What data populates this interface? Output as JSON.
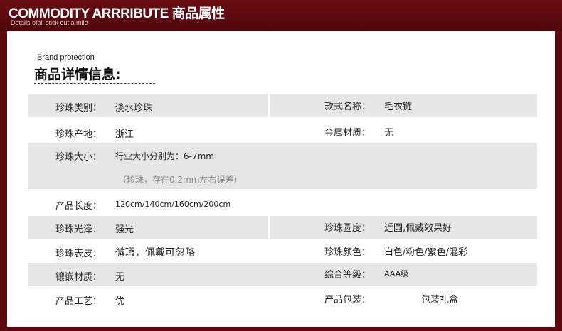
{
  "header": {
    "title": "COMMODITY ARRRIBUTE 商品属性",
    "subtitle": "Details ofall stick out a mile"
  },
  "brand": {
    "en": "Brand protection",
    "cn": "商品详情信息:",
    "dashes": "- - - - - - - - - - - - - - - -"
  },
  "rows": [
    {
      "left_label": "珍珠类别：",
      "left_value": "淡水珍珠",
      "right_label": "款式名称：",
      "right_value": "毛衣链"
    },
    {
      "left_label": "珍珠产地：",
      "left_value": "浙江",
      "right_label": "金属材质：",
      "right_value": "无"
    },
    {
      "left_label": "珍珠大小：",
      "left_value": "行业大小分别为：6-7mm",
      "note": "（珍珠，存在0.2mm左右误差）"
    },
    {
      "left_label": "产品长度：",
      "left_value": "120cm/140cm/160cm/200cm"
    },
    {
      "left_label": "珍珠光泽：",
      "left_value": "强光",
      "right_label": "珍珠圆度：",
      "right_value": "近圆,佩戴效果好"
    },
    {
      "left_label": "珍珠表皮：",
      "left_value": "微瑕，佩戴可忽略",
      "right_label": "珍珠颜色：",
      "right_value": "白色/粉色/紫色/混彩"
    },
    {
      "left_label": "镶嵌材质：",
      "left_value": "无",
      "right_label": "综合等级：",
      "right_value": "AAA级"
    },
    {
      "left_label": "产品工艺：",
      "left_value": "优",
      "right_label": "产品包装：",
      "right_value": "包装礼盒"
    }
  ]
}
